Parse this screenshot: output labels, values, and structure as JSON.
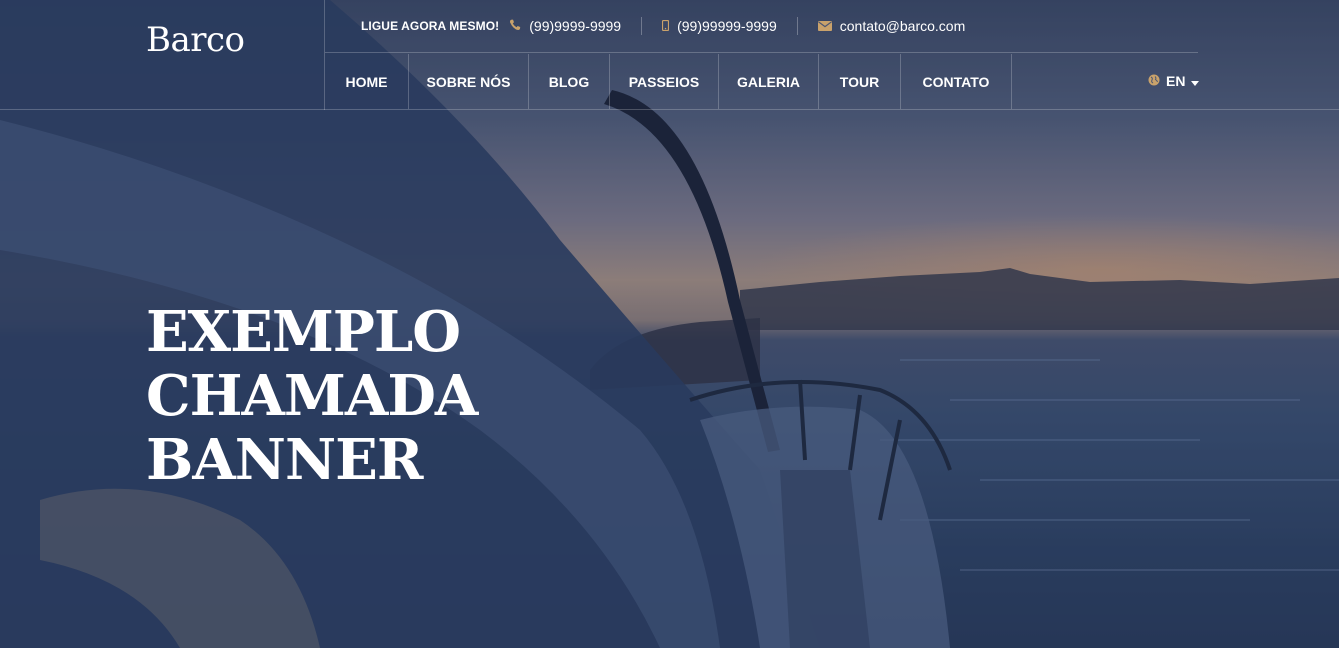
{
  "brand": {
    "logo_text": "Barco"
  },
  "topbar": {
    "call_label": "LIGUE AGORA MESMO!",
    "phone": "(99)9999-9999",
    "mobile": "(99)99999-9999",
    "email": "contato@barco.com",
    "icons": [
      "phone-icon",
      "mobile-icon",
      "envelope-icon"
    ],
    "icon_color": "#c9a26b"
  },
  "nav": {
    "items": [
      {
        "label": "HOME"
      },
      {
        "label": "SOBRE NÓS"
      },
      {
        "label": "BLOG"
      },
      {
        "label": "PASSEIOS"
      },
      {
        "label": "GALERIA"
      },
      {
        "label": "TOUR"
      },
      {
        "label": "CONTATO"
      }
    ]
  },
  "language": {
    "current": "EN",
    "icon": "globe-icon"
  },
  "banner": {
    "lines": [
      "EXEMPLO",
      "CHAMADA",
      "BANNER"
    ]
  },
  "colors": {
    "overlay": "#1c2846",
    "text": "#ffffff",
    "accent": "#c9a26b"
  }
}
